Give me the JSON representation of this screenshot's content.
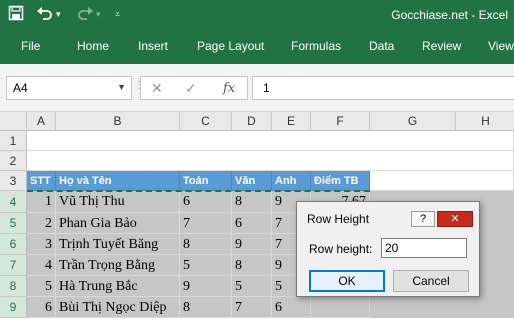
{
  "window": {
    "title": "Gocchiase.net - Excel",
    "save_icon": "save-icon",
    "undo_icon": "undo-icon",
    "redo_icon": "redo-icon",
    "customize_icon": "customize-quick-access-icon"
  },
  "ribbon": {
    "tabs": [
      "File",
      "Home",
      "Insert",
      "Page Layout",
      "Formulas",
      "Data",
      "Review",
      "View"
    ],
    "accent": "#217346"
  },
  "formula_bar": {
    "name_box": "A4",
    "cancel_symbol": "✕",
    "enter_symbol": "✓",
    "fx_symbol": "fx",
    "content": "1"
  },
  "sheet": {
    "columns": [
      "A",
      "B",
      "C",
      "D",
      "E",
      "F",
      "G",
      "H"
    ],
    "rows": [
      "1",
      "2",
      "3",
      "4",
      "5",
      "6",
      "7",
      "8",
      "9"
    ],
    "header_row": [
      "STT",
      "Họ và Tên",
      "Toán",
      "Văn",
      "Anh",
      "Điểm TB"
    ],
    "data": [
      [
        "1",
        "Vũ Thị Thu",
        "6",
        "8",
        "9",
        "7.67"
      ],
      [
        "2",
        "Phan Gia Bảo",
        "7",
        "6",
        "7",
        ""
      ],
      [
        "3",
        "Trịnh Tuyết Băng",
        "8",
        "9",
        "7",
        ""
      ],
      [
        "4",
        "Trần Trọng Bằng",
        "5",
        "8",
        "9",
        ""
      ],
      [
        "5",
        "Hà Trung Bắc",
        "9",
        "5",
        "5",
        ""
      ],
      [
        "6",
        "Bùi Thị Ngọc Diệp",
        "8",
        "7",
        "6",
        ""
      ]
    ],
    "header_fill": "#5b9bd5",
    "selection_fill": "#c6c6c6"
  },
  "dialog": {
    "title": "Row Height",
    "help": "?",
    "close": "✕",
    "label": "Row height:",
    "value": "20",
    "ok": "OK",
    "cancel": "Cancel"
  }
}
